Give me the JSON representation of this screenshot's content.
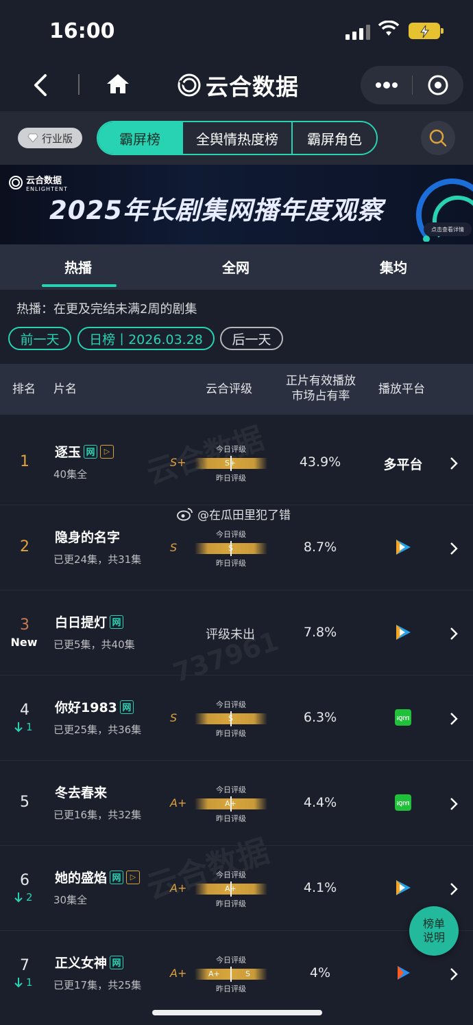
{
  "status": {
    "time": "16:00"
  },
  "nav": {
    "title": "云合数据"
  },
  "filter": {
    "industry_label": "行业版",
    "segments": [
      "霸屏榜",
      "全舆情热度榜",
      "霸屏角色"
    ]
  },
  "banner": {
    "logo_cn": "云合数据",
    "logo_en": "ENLIGHTENT",
    "title": "2025年长剧集网播年度观察",
    "cta": "点击查看详情"
  },
  "tabs": [
    "热播",
    "全网",
    "集均"
  ],
  "description": "热播：在更及完结未满2周的剧集",
  "date_nav": {
    "prev": "前一天",
    "current": "日榜丨2026.03.28",
    "next": "后一天"
  },
  "table_header": {
    "rank": "排名",
    "title": "片名",
    "grade": "云合评级",
    "share_line1": "正片有效播放",
    "share_line2": "市场占有率",
    "platform": "播放平台"
  },
  "grade_labels": {
    "today": "今日评级",
    "yesterday": "昨日评级"
  },
  "not_rated": "评级未出",
  "weibo_tag": "@在瓜田里犯了错",
  "watermark_id": "737961",
  "rows": [
    {
      "rank": "1",
      "title": "逐玉",
      "eps": "40集全",
      "grade": "S+",
      "bar": "S+",
      "share": "43.9%",
      "platform": "多平台"
    },
    {
      "rank": "2",
      "title": "隐身的名字",
      "eps": "已更24集，共31集",
      "grade": "S",
      "bar": "S",
      "share": "8.7%",
      "platform": "tencent"
    },
    {
      "rank": "3",
      "new": "New",
      "title": "白日提灯",
      "eps": "已更5集，共40集",
      "share": "7.8%",
      "platform": "tencent"
    },
    {
      "rank": "4",
      "trend": "1",
      "title": "你好1983",
      "eps": "已更25集，共36集",
      "grade": "S",
      "bar": "S",
      "share": "6.3%",
      "platform": "iqiyi"
    },
    {
      "rank": "5",
      "title": "冬去春来",
      "eps": "已更16集，共32集",
      "grade": "A+",
      "bar": "A+",
      "share": "4.4%",
      "platform": "iqiyi"
    },
    {
      "rank": "6",
      "trend": "2",
      "title": "她的盛焰",
      "eps": "30集全",
      "grade": "A+",
      "bar": "A+",
      "share": "4.1%",
      "platform": "tencent"
    },
    {
      "rank": "7",
      "trend": "1",
      "title": "正义女神",
      "eps": "已更17集，共25集",
      "grade": "A+",
      "bar": "A+",
      "bar_right": "S",
      "share": "4%",
      "platform": "youku"
    }
  ],
  "badges": {
    "net": "网",
    "play": "▷"
  },
  "fab": {
    "line1": "榜单",
    "line2": "说明"
  },
  "colors": {
    "accent": "#28d3b3",
    "gold": "#d9a63c",
    "bg": "#1b1f2b"
  }
}
